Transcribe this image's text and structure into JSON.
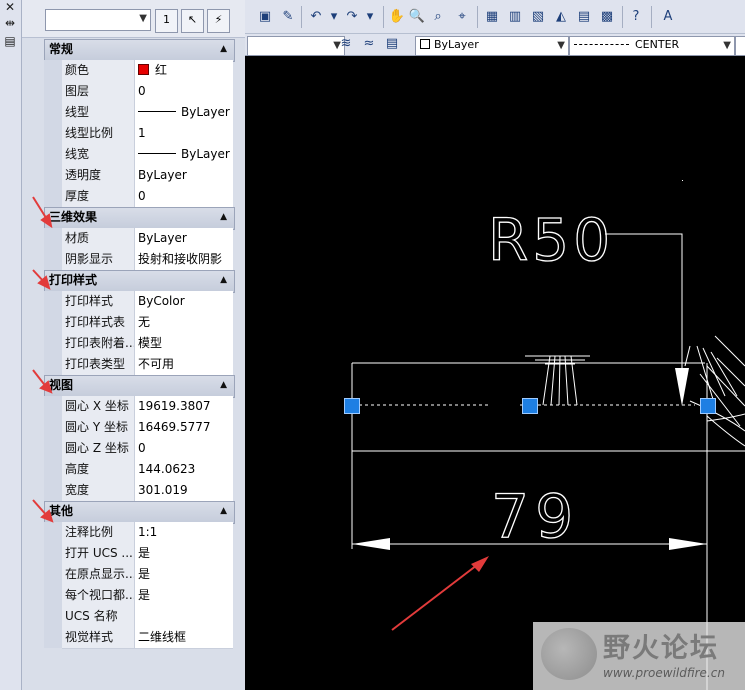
{
  "palette": {
    "sections": [
      {
        "title": "常规",
        "rows": [
          {
            "key": "颜色",
            "value": "红"
          },
          {
            "key": "图层",
            "value": "0"
          },
          {
            "key": "线型",
            "value": "ByLayer"
          },
          {
            "key": "线型比例",
            "value": "1"
          },
          {
            "key": "线宽",
            "value": "ByLayer"
          },
          {
            "key": "透明度",
            "value": "ByLayer"
          },
          {
            "key": "厚度",
            "value": "0"
          }
        ]
      },
      {
        "title": "三维效果",
        "rows": [
          {
            "key": "材质",
            "value": "ByLayer"
          },
          {
            "key": "阴影显示",
            "value": "投射和接收阴影"
          }
        ]
      },
      {
        "title": "打印样式",
        "rows": [
          {
            "key": "打印样式",
            "value": "ByColor"
          },
          {
            "key": "打印样式表",
            "value": "无"
          },
          {
            "key": "打印表附着...",
            "value": "模型"
          },
          {
            "key": "打印表类型",
            "value": "不可用"
          }
        ]
      },
      {
        "title": "视图",
        "rows": [
          {
            "key": "圆心 X 坐标",
            "value": "19619.3807"
          },
          {
            "key": "圆心 Y 坐标",
            "value": "16469.5777"
          },
          {
            "key": "圆心 Z 坐标",
            "value": "0"
          },
          {
            "key": "高度",
            "value": "144.0623"
          },
          {
            "key": "宽度",
            "value": "301.019"
          }
        ]
      },
      {
        "title": "其他",
        "rows": [
          {
            "key": "注释比例",
            "value": "1:1"
          },
          {
            "key": "打开 UCS ...",
            "value": "是"
          },
          {
            "key": "在原点显示...",
            "value": "是"
          },
          {
            "key": "每个视口都...",
            "value": "是"
          },
          {
            "key": "UCS 名称",
            "value": ""
          },
          {
            "key": "视觉样式",
            "value": "二维线框"
          }
        ]
      }
    ]
  },
  "toolbar": {
    "layer_combo": "ByLayer",
    "linetype_combo": "CENTER"
  },
  "drawing": {
    "radius_text": "R50",
    "dim_text": "79"
  },
  "watermark": {
    "title": "野火论坛",
    "url": "www.proewildfire.cn"
  },
  "colors": {
    "grip": "#1e7fe3",
    "annotation_arrow": "#e23b3b",
    "object_color": "#e60000"
  }
}
